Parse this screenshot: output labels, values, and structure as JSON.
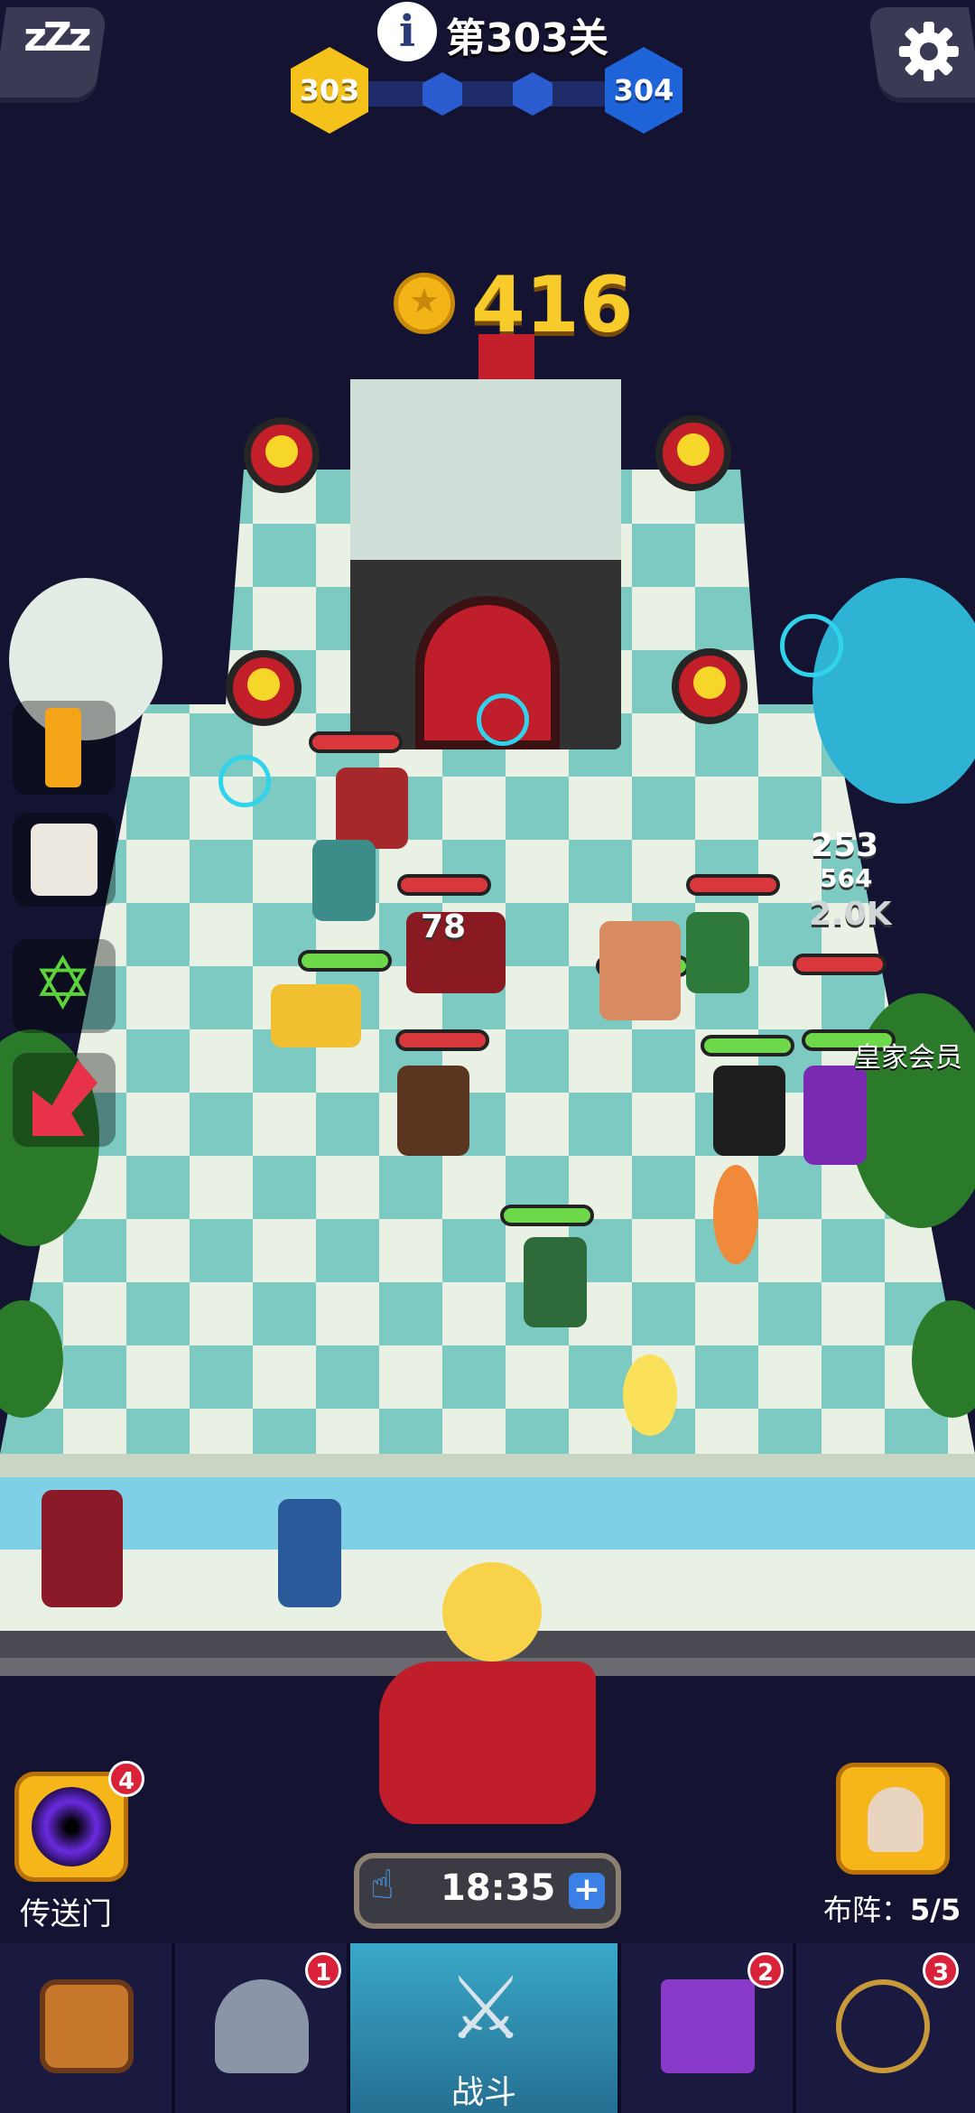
{
  "header": {
    "level_title": "第303关",
    "current_level": "303",
    "next_level": "304",
    "sleep_label": "zZz"
  },
  "coins": {
    "value": "416"
  },
  "battle": {
    "damage_text_1": "78",
    "damage_text_2": "253",
    "damage_text_3": "564",
    "damage_text_4": "2.0K",
    "vip_label": "皇家会员"
  },
  "portal": {
    "label": "传送门",
    "badge": "4"
  },
  "formation": {
    "label": "布阵：",
    "count": "5/5"
  },
  "timer": {
    "value": "18:35",
    "plus": "+"
  },
  "nav": {
    "items": [
      {
        "name": "chest",
        "label": "",
        "badge": ""
      },
      {
        "name": "helmet",
        "label": "",
        "badge": "1"
      },
      {
        "name": "battle",
        "label": "战斗",
        "badge": ""
      },
      {
        "name": "spellbook",
        "label": "",
        "badge": "2"
      },
      {
        "name": "amulet",
        "label": "",
        "badge": "3"
      }
    ]
  },
  "colors": {
    "background": "#141432",
    "board_light": "#e9f0e4",
    "board_teal": "#7ccac2",
    "accent_gold": "#f6b519",
    "accent_red": "#c21f2a",
    "nav_active": "#3aa8c8"
  }
}
